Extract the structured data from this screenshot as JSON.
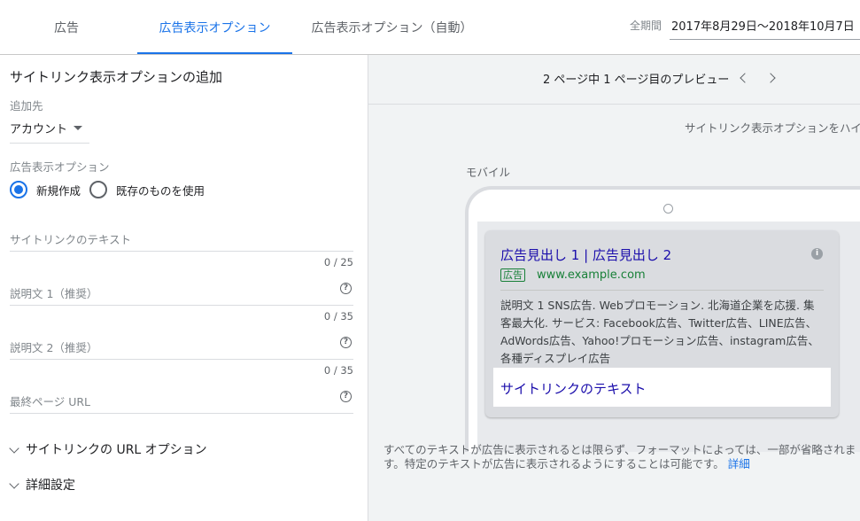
{
  "tabs": [
    {
      "label": "広告"
    },
    {
      "label": "広告表示オプション"
    },
    {
      "label": "広告表示オプション（自動）"
    }
  ],
  "period": {
    "label": "全期間",
    "value": "2017年8月29日〜2018年10月7日"
  },
  "form": {
    "title": "サイトリンク表示オプションの追加",
    "destination": {
      "label": "追加先",
      "value": "アカウント"
    },
    "extension": {
      "label": "広告表示オプション",
      "options": [
        "新規作成",
        "既存のものを使用"
      ],
      "selected": "新規作成"
    },
    "fields": [
      {
        "placeholder": "サイトリンクのテキスト",
        "counter": "0 / 25",
        "help": false
      },
      {
        "placeholder": "説明文 1（推奨）",
        "counter": "0 / 35",
        "help": true
      },
      {
        "placeholder": "説明文 2（推奨）",
        "counter": "0 / 35",
        "help": true
      },
      {
        "placeholder": "最終ページ URL",
        "counter": "",
        "help": true
      }
    ],
    "sections": [
      "サイトリンクの URL オプション",
      "詳細設定"
    ]
  },
  "preview": {
    "page_text": "2 ページ中 1 ページ目のプレビュー",
    "hover_note": "サイトリンク表示オプションをハイ",
    "device_label": "モバイル",
    "ad": {
      "headline": "広告見出し 1 | 広告見出し 2",
      "badge": "広告",
      "url": "www.example.com",
      "description": "説明文 1 SNS広告. Webプロモーション. 北海道企業を応援. 集客最大化. サービス: Facebook広告、Twitter広告、LINE広告、AdWords広告、Yahoo!プロモーション広告、instagram広告、各種ディスプレイ広告",
      "sitelink": "サイトリンクのテキスト"
    },
    "footer_note": "すべてのテキストが広告に表示されるとは限らず、フォーマットによっては、一部が省略されます。特定のテキストが広告に表示されるようにすることは可能です。",
    "detail_link": "詳細"
  },
  "colors": {
    "accent": "#1a73e8",
    "ad_link": "#1a0dab",
    "ad_green": "#188038"
  }
}
